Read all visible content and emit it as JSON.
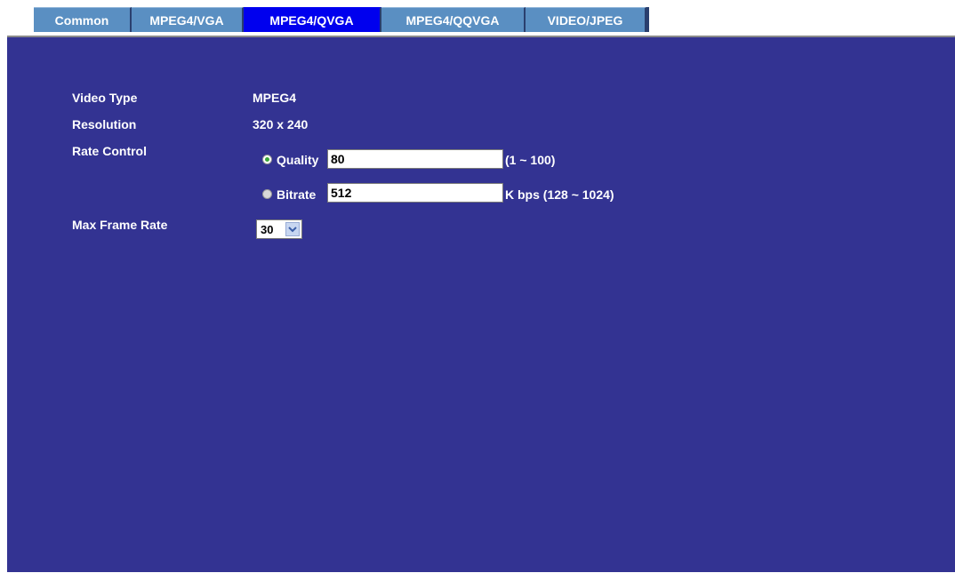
{
  "tabs": [
    {
      "label": "Common",
      "active": false
    },
    {
      "label": "MPEG4/VGA",
      "active": false
    },
    {
      "label": "MPEG4/QVGA",
      "active": true
    },
    {
      "label": "MPEG4/QQVGA",
      "active": false
    },
    {
      "label": "VIDEO/JPEG",
      "active": false
    }
  ],
  "form": {
    "video_type": {
      "label": "Video Type",
      "value": "MPEG4"
    },
    "resolution": {
      "label": "Resolution",
      "value": "320 x 240"
    },
    "rate_control": {
      "label": "Rate Control",
      "quality": {
        "label": "Quality",
        "value": "80",
        "range": "(1 ~ 100)",
        "selected": true
      },
      "bitrate": {
        "label": "Bitrate",
        "value": "512",
        "range": "K bps (128 ~ 1024)",
        "selected": false
      }
    },
    "max_frame_rate": {
      "label": "Max Frame Rate",
      "value": "30"
    }
  },
  "colors": {
    "panel_bg": "#333392",
    "tab_bg": "#5a8fc2",
    "tab_active_bg": "#0000ee",
    "text": "#ffffff"
  }
}
